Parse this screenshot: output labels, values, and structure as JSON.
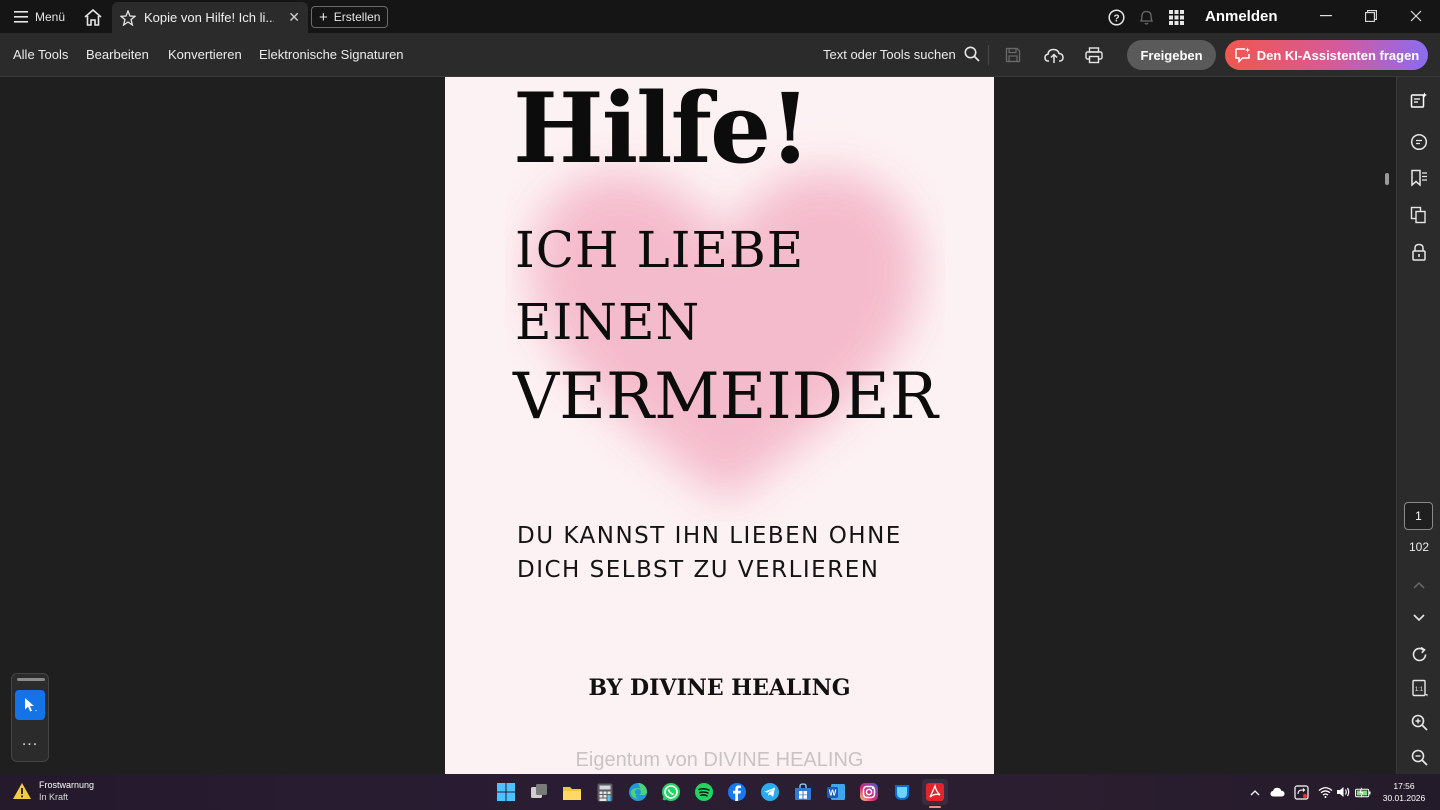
{
  "titlebar": {
    "menu_label": "Menü",
    "tab_title": "Kopie von Hilfe! Ich li...",
    "create_label": "Erstellen",
    "signin_label": "Anmelden",
    "icons": [
      "menu-icon",
      "home-icon",
      "star-icon",
      "close-icon",
      "plus-icon",
      "help-icon",
      "bell-icon",
      "apps-grid-icon",
      "minimize-icon",
      "restore-icon",
      "close-window-icon"
    ]
  },
  "toolbar": {
    "nav": [
      "Alle Tools",
      "Bearbeiten",
      "Konvertieren",
      "Elektronische Signaturen"
    ],
    "search_label": "Text oder Tools suchen",
    "share_label": "Freigeben",
    "ai_label": "Den KI-Assistenten fragen",
    "accent_ai_start": "#f0574e",
    "accent_ai_end": "#8a6cf0"
  },
  "document": {
    "title": "Hilfe!",
    "subtitle_line1": "ICH LIEBE",
    "subtitle_line2": "EINEN",
    "subtitle_line3": "VERMEIDER",
    "tagline_line1": "DU KANNST IHN LIEBEN OHNE",
    "tagline_line2": "DICH SELBST ZU VERLIEREN",
    "author": "BY DIVINE HEALING",
    "watermark": "Eigentum von DIVINE HEALING",
    "page_bg": "#fdf2f3",
    "heart_color": "#f4b6c8"
  },
  "navigation": {
    "current_page": "1",
    "total_pages": "102"
  },
  "float_panel": {
    "more_label": "..."
  },
  "taskbar": {
    "weather_title": "Frostwarnung",
    "weather_status": "In Kraft",
    "time": "17:56",
    "date": "30.01.2026",
    "apps": [
      "windows-start-icon",
      "task-view-icon",
      "file-explorer-icon",
      "calculator-icon",
      "edge-icon",
      "whatsapp-icon",
      "spotify-icon",
      "facebook-icon",
      "telegram-icon",
      "store-icon",
      "word-icon",
      "instagram-icon",
      "copilot-icon",
      "acrobat-icon"
    ]
  }
}
